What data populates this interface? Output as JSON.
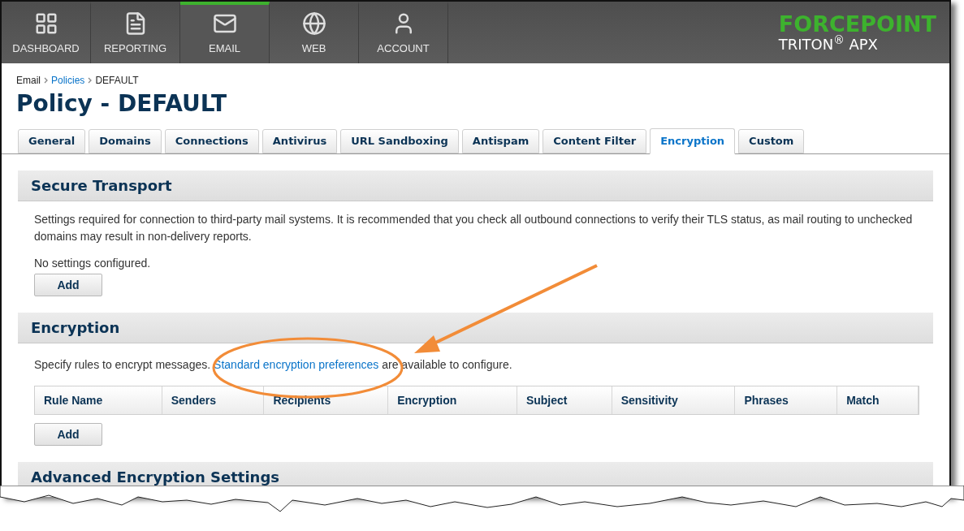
{
  "nav": [
    {
      "label": "DASHBOARD",
      "kind": "grid",
      "selected": false
    },
    {
      "label": "REPORTING",
      "kind": "document",
      "selected": false
    },
    {
      "label": "EMAIL",
      "kind": "mail",
      "selected": true
    },
    {
      "label": "WEB",
      "kind": "globe",
      "selected": false
    },
    {
      "label": "ACCOUNT",
      "kind": "user",
      "selected": false
    }
  ],
  "logo": {
    "brand": "FORCEPOINT",
    "product": "TRITON$^{®}$ APX"
  },
  "breadcrumb": [
    {
      "label": "Email",
      "kind": "text"
    },
    {
      "label": "Policies",
      "kind": "link"
    },
    {
      "label": "DEFAULT",
      "kind": "text"
    }
  ],
  "title": "Policy - DEFAULT",
  "tabs": [
    {
      "label": "General",
      "selected": false
    },
    {
      "label": "Domains",
      "selected": false
    },
    {
      "label": "Connections",
      "selected": false
    },
    {
      "label": "Antivirus",
      "selected": false
    },
    {
      "label": "URL Sandboxing",
      "selected": false
    },
    {
      "label": "Antispam",
      "selected": false
    },
    {
      "label": "Content Filter",
      "selected": false
    },
    {
      "label": "Encryption",
      "selected": true
    },
    {
      "label": "Custom",
      "selected": false
    }
  ],
  "secure_transport": {
    "title": "Secure Transport",
    "description": "Settings required for connection to third-party mail systems. It is recommended that you check all outbound connections to verify their TLS status, as mail routing to unchecked domains may result in non-delivery reports.",
    "status": "No settings configured.",
    "button": "Add"
  },
  "encryption": {
    "title": "Encryption",
    "text_before": "Specify rules to encrypt messages.",
    "link": "Standard encryption preferences",
    "text_after": "are available to configure.",
    "table": {
      "columns": [
        "Rule Name",
        "Senders",
        "Recipients",
        "Encryption",
        "Subject",
        "Sensitivity",
        "Phrases",
        "Match"
      ]
    },
    "button": "Add"
  },
  "advanced": {
    "title": "Advanced Encryption Settings"
  }
}
